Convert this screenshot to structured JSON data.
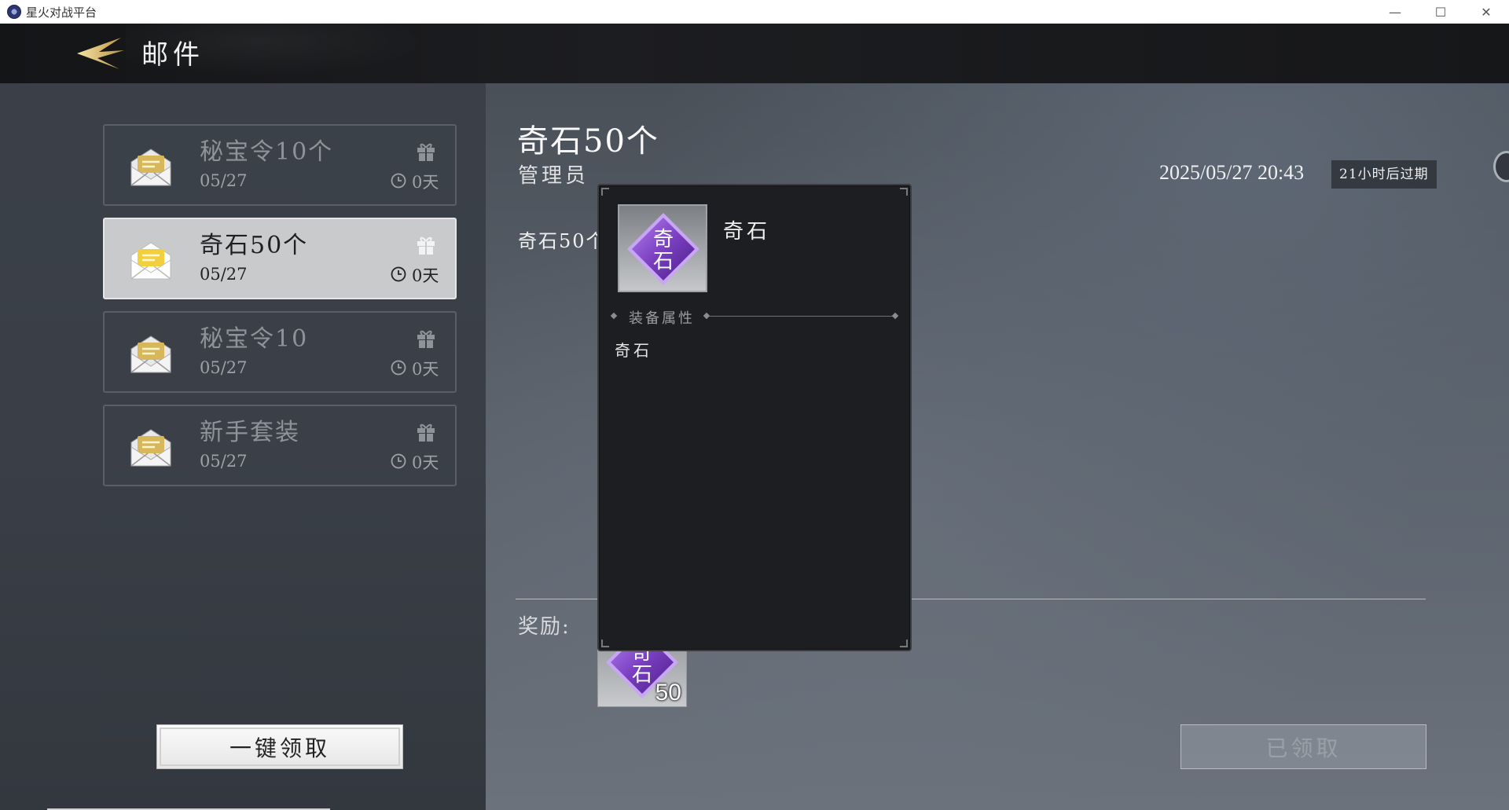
{
  "window": {
    "title": "星火对战平台",
    "controls": {
      "minimize": "—",
      "maximize": "☐",
      "close": "✕"
    }
  },
  "header": {
    "title": "邮件"
  },
  "mail_list": [
    {
      "title": "秘宝令10个",
      "date": "05/27",
      "remaining": "0天",
      "active": false
    },
    {
      "title": "奇石50个",
      "date": "05/27",
      "remaining": "0天",
      "active": true
    },
    {
      "title": "秘宝令10",
      "date": "05/27",
      "remaining": "0天",
      "active": false
    },
    {
      "title": "新手套装",
      "date": "05/27",
      "remaining": "0天",
      "active": false
    }
  ],
  "claim_all_label": "一键领取",
  "detail": {
    "title": "奇石50个",
    "sender": "管理员",
    "datetime": "2025/05/27 20:43",
    "expire": "21小时后过期",
    "body": "奇石50个",
    "reward_label": "奖励:",
    "reward": {
      "icon_text_1": "奇",
      "icon_text_2": "石",
      "count": "50"
    },
    "claimed_label": "已领取"
  },
  "tooltip": {
    "item_name": "奇石",
    "icon_text_1": "奇",
    "icon_text_2": "石",
    "attr_title": "装备属性",
    "attr_text": "奇石"
  },
  "colors": {
    "gem_purple": "#7a3fc0",
    "gem_light": "#b27ef0",
    "envelope_gold": "#d8b65a",
    "envelope_active": "#f2cf3c"
  }
}
